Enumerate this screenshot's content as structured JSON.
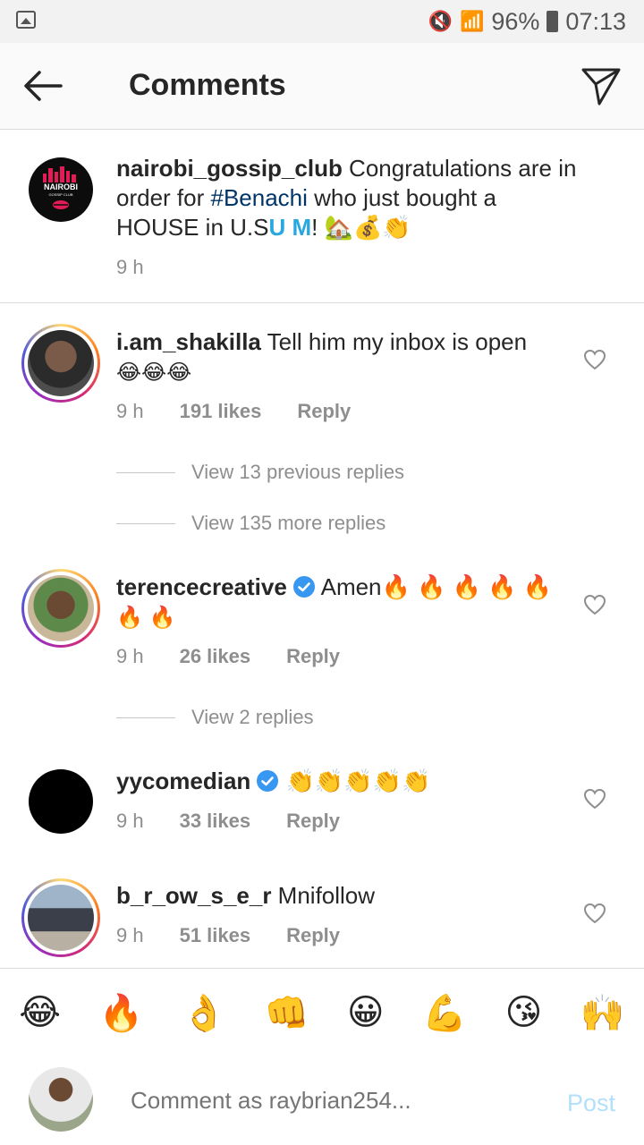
{
  "status": {
    "battery": "96%",
    "time": "07:13"
  },
  "header": {
    "title": "Comments"
  },
  "post": {
    "username": "nairobi_gossip_club",
    "text_1": " Congratulations are in order for ",
    "hashtag": "#Benachi",
    "text_2": " who just bought a HOUSE in U.S",
    "text_um": "U M",
    "text_3": "! 🏡💰👏",
    "time": "9 h",
    "avatar_top": "NAIROBI",
    "avatar_bottom": "GOSSIP CLUB"
  },
  "comments": [
    {
      "username": "i.am_shakilla",
      "text": " Tell him my inbox is open",
      "emoji_line": "😂😂😂",
      "time": "9 h",
      "likes": "191 likes",
      "reply": "Reply",
      "verified": false
    },
    {
      "username": "terencecreative",
      "text": " Amen🔥 🔥 🔥 🔥 🔥",
      "emoji_line": "🔥 🔥",
      "time": "9 h",
      "likes": "26 likes",
      "reply": "Reply",
      "verified": true
    },
    {
      "username": "yycomedian",
      "text": " 👏👏👏👏👏",
      "time": "9 h",
      "likes": "33 likes",
      "reply": "Reply",
      "verified": true
    },
    {
      "username": "b_r_ow_s_e_r",
      "text": " Mnifollow",
      "time": "9 h",
      "likes": "51 likes",
      "reply": "Reply",
      "verified": false
    }
  ],
  "reply_threads": {
    "previous": "View 13 previous replies",
    "more": "View 135 more replies",
    "terence": "View 2 replies"
  },
  "emoji_bar": [
    "😂",
    "🔥",
    "👌",
    "👊",
    "😀",
    "💪",
    "😘",
    "🙌"
  ],
  "composer": {
    "placeholder": "Comment as raybrian254...",
    "post_label": "Post"
  }
}
